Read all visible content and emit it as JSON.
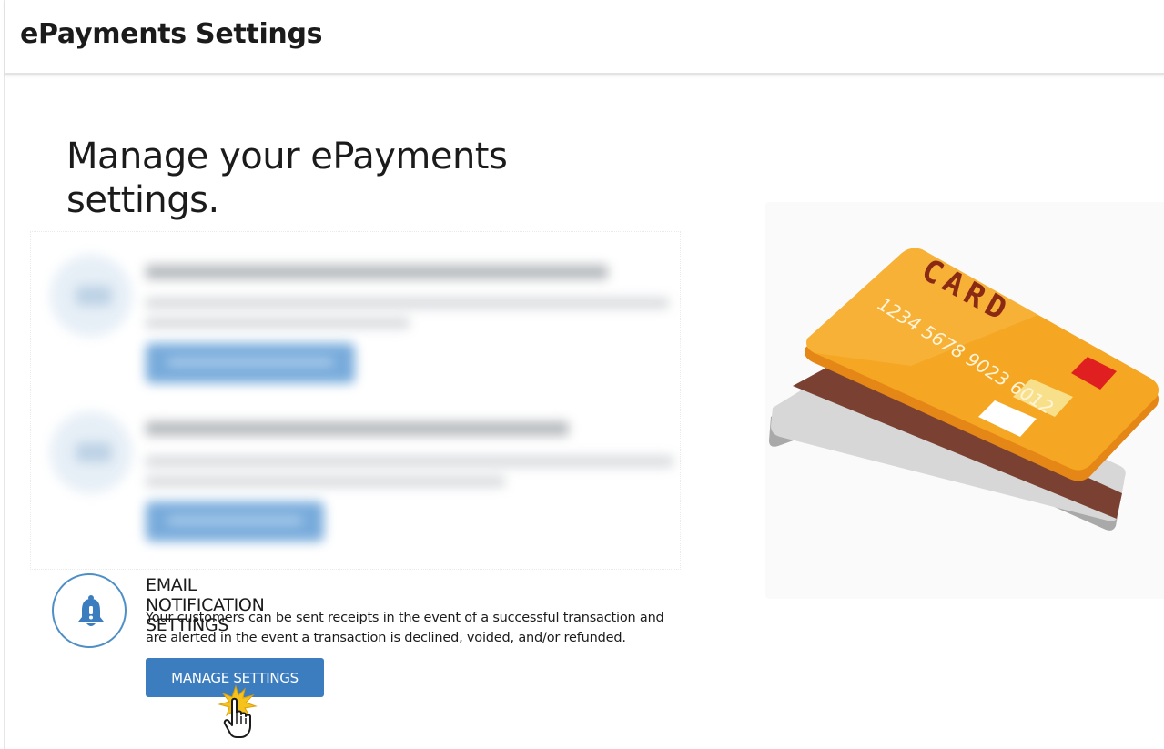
{
  "header": {
    "title": "ePayments Settings"
  },
  "intro": {
    "heading_line1": "Manage your ePayments",
    "heading_line2": "settings."
  },
  "email_notifications": {
    "title": "EMAIL NOTIFICATION SETTINGS",
    "description_line1": "Your customers can be sent receipts in the event of a successful transaction and",
    "description_line2": "are alerted in the event a transaction is declined, voided, and/or refunded.",
    "button_label": "MANAGE SETTINGS",
    "icon": "bell-icon"
  },
  "illustration": {
    "card_word": "CARD",
    "card_number": "1234 5678 9023 6012"
  },
  "colors": {
    "accent": "#3c7dbf",
    "icon_ring": "#4f8fc5",
    "card_orange": "#f5a623",
    "stripe": "#7a4132"
  }
}
